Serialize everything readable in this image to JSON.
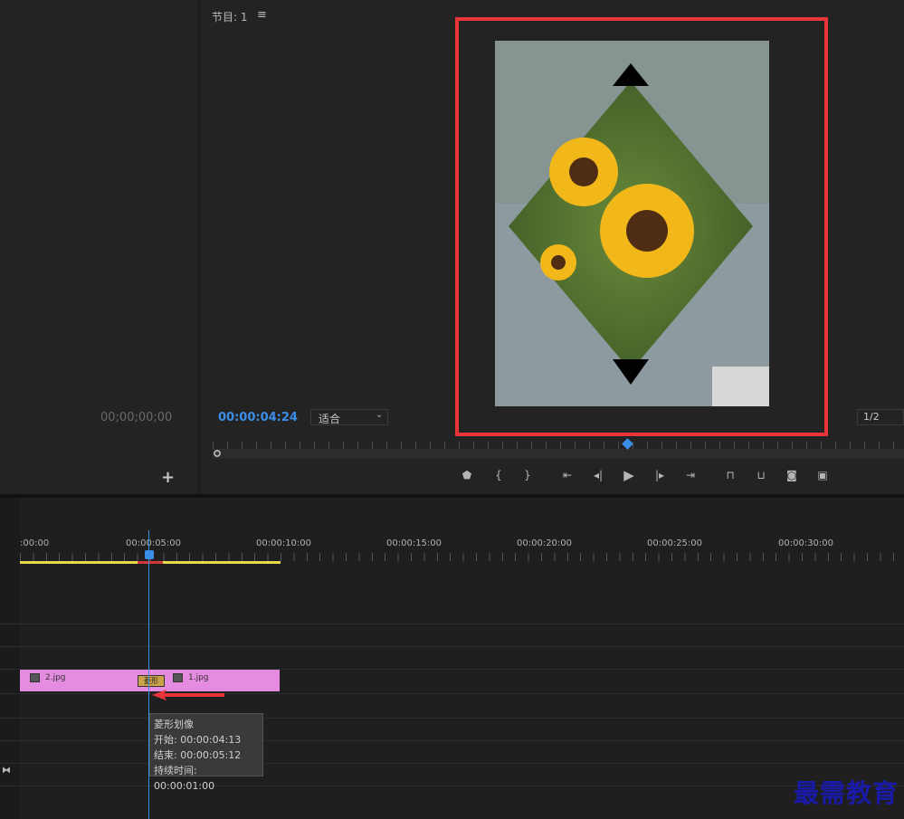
{
  "source_panel": {
    "timecode": "00;00;00;00"
  },
  "program": {
    "title": "节目: 1",
    "timecode": "00:00:04:24",
    "zoom": "适合",
    "resolution": "1/2"
  },
  "transport": {
    "icons": [
      "marker-icon",
      "mark-in-icon",
      "mark-out-icon",
      "go-to-in-icon",
      "step-back-icon",
      "play-icon",
      "step-forward-icon",
      "go-to-out-icon",
      "lift-icon",
      "extract-icon",
      "export-frame-icon",
      "compare-icon"
    ]
  },
  "timeline": {
    "ruler": [
      ":00:00",
      "00:00:05:00",
      "00:00:10:00",
      "00:00:15:00",
      "00:00:20:00",
      "00:00:25:00",
      "00:00:30:00"
    ],
    "clips": [
      {
        "name": "2.jpg"
      },
      {
        "name": "1.jpg"
      }
    ],
    "transition_label": "菱形"
  },
  "tooltip": {
    "name": "菱形划像",
    "start": "开始: 00:00:04:13",
    "end": "结束: 00:00:05:12",
    "duration": "持续时间: 00:00:01:00"
  },
  "watermark": "最需教育",
  "colors": {
    "accent": "#3b8ee8",
    "highlight_box": "#e8353a",
    "clip": "#e58ce0",
    "work_area": "#e8d94a"
  }
}
